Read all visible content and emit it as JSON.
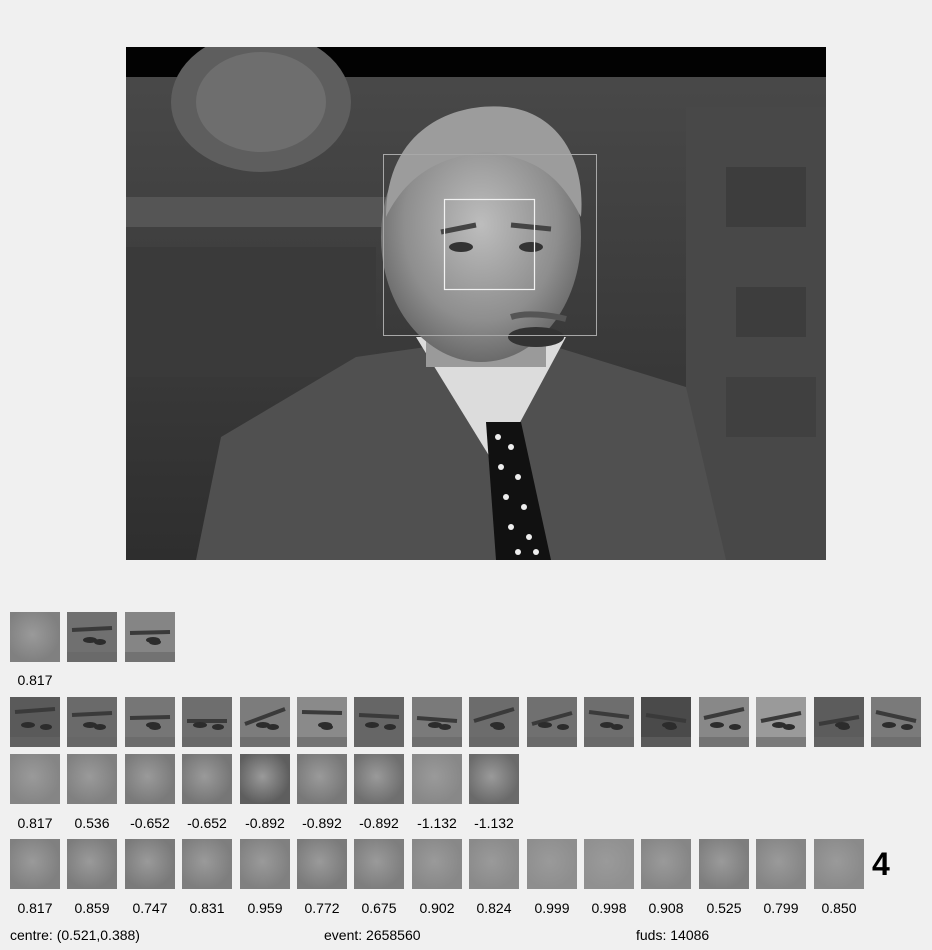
{
  "viewer": {
    "frame_icon": "portrait-photo",
    "status": {
      "centre": "centre: (0.521,0.388)",
      "event": "event: 2658560",
      "fuds": "fuds: 14086"
    },
    "count_label": "4"
  },
  "rows": {
    "row1": {
      "thumbs": 3,
      "values": [
        "0.817"
      ]
    },
    "row2": {
      "thumbs": 16
    },
    "row3": {
      "thumbs": 9,
      "values": [
        "0.817",
        "0.536",
        "-0.652",
        "-0.652",
        "-0.892",
        "-0.892",
        "-0.892",
        "-1.132",
        "-1.132"
      ]
    },
    "row4": {
      "thumbs": 15,
      "values": [
        "0.817",
        "0.859",
        "0.747",
        "0.831",
        "0.959",
        "0.772",
        "0.675",
        "0.902",
        "0.824",
        "0.999",
        "0.998",
        "0.908",
        "0.525",
        "0.799",
        "0.850"
      ]
    }
  }
}
